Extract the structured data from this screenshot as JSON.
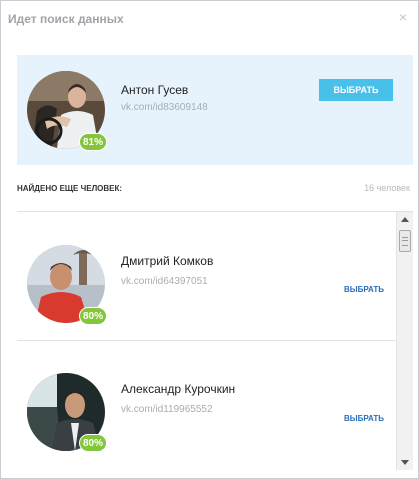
{
  "dialog": {
    "title": "Идет поиск данных",
    "close_glyph": "×"
  },
  "top_match": {
    "name": "Антон Гусев",
    "link": "vk.com/id83609148",
    "match_percent": "81%",
    "select_label": "ВЫБРАТЬ"
  },
  "found": {
    "label": "НАЙДЕНО ЕЩЕ ЧЕЛОВЕК:",
    "count": "16 человек"
  },
  "results": [
    {
      "name": "Дмитрий Комков",
      "link": "vk.com/id64397051",
      "match_percent": "80%",
      "select_label": "ВЫБРАТЬ"
    },
    {
      "name": "Александр Курочкин",
      "link": "vk.com/id119965552",
      "match_percent": "80%",
      "select_label": "ВЫБРАТЬ"
    }
  ],
  "colors": {
    "accent": "#48c0ea",
    "badge": "#82c63a",
    "highlight_bg": "#e6f3fc",
    "link_button": "#2a6ebb"
  },
  "icons": {
    "close": "close-icon",
    "scroll_up": "arrow-up-icon",
    "scroll_down": "arrow-down-icon"
  }
}
